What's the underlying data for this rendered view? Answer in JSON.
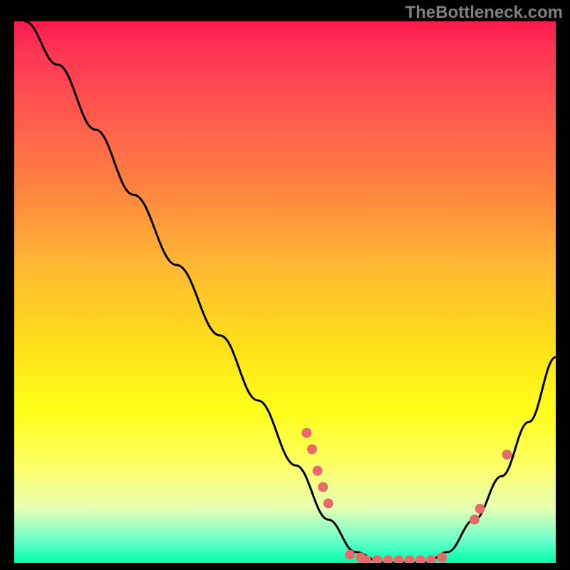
{
  "attribution": "TheBottleneck.com",
  "chart_data": {
    "type": "line",
    "title": "",
    "xlabel": "",
    "ylabel": "",
    "xlim": [
      0,
      100
    ],
    "ylim": [
      0,
      100
    ],
    "gradient_colors": {
      "top": "#ff1a4d",
      "upper_mid": "#ff8040",
      "mid": "#ffe01a",
      "lower_mid": "#ffff66",
      "bottom": "#00ffaa"
    },
    "series": [
      {
        "name": "bottleneck-curve",
        "color": "#000000",
        "points": [
          {
            "x": 2,
            "y": 100
          },
          {
            "x": 8,
            "y": 92
          },
          {
            "x": 15,
            "y": 80
          },
          {
            "x": 22,
            "y": 68
          },
          {
            "x": 30,
            "y": 55
          },
          {
            "x": 38,
            "y": 42
          },
          {
            "x": 45,
            "y": 30
          },
          {
            "x": 52,
            "y": 18
          },
          {
            "x": 58,
            "y": 8
          },
          {
            "x": 63,
            "y": 2
          },
          {
            "x": 68,
            "y": 0
          },
          {
            "x": 72,
            "y": 0
          },
          {
            "x": 76,
            "y": 0
          },
          {
            "x": 80,
            "y": 2
          },
          {
            "x": 85,
            "y": 8
          },
          {
            "x": 90,
            "y": 16
          },
          {
            "x": 95,
            "y": 26
          },
          {
            "x": 100,
            "y": 38
          }
        ]
      }
    ],
    "markers": [
      {
        "x": 54,
        "y": 24,
        "color": "#e86a6a"
      },
      {
        "x": 55,
        "y": 21,
        "color": "#e86a6a"
      },
      {
        "x": 56,
        "y": 17,
        "color": "#e86a6a"
      },
      {
        "x": 57,
        "y": 14,
        "color": "#e86a6a"
      },
      {
        "x": 58,
        "y": 11,
        "color": "#e86a6a"
      },
      {
        "x": 62,
        "y": 1.5,
        "color": "#e86a6a"
      },
      {
        "x": 64,
        "y": 1,
        "color": "#e86a6a"
      },
      {
        "x": 65,
        "y": 0.5,
        "color": "#e86a6a"
      },
      {
        "x": 67,
        "y": 0.5,
        "color": "#e86a6a"
      },
      {
        "x": 69,
        "y": 0.5,
        "color": "#e86a6a"
      },
      {
        "x": 71,
        "y": 0.5,
        "color": "#e86a6a"
      },
      {
        "x": 73,
        "y": 0.5,
        "color": "#e86a6a"
      },
      {
        "x": 75,
        "y": 0.5,
        "color": "#e86a6a"
      },
      {
        "x": 77,
        "y": 0.5,
        "color": "#e86a6a"
      },
      {
        "x": 79,
        "y": 1,
        "color": "#e86a6a"
      },
      {
        "x": 85,
        "y": 8,
        "color": "#e86a6a"
      },
      {
        "x": 86,
        "y": 10,
        "color": "#e86a6a"
      },
      {
        "x": 91,
        "y": 20,
        "color": "#e86a6a"
      }
    ]
  }
}
